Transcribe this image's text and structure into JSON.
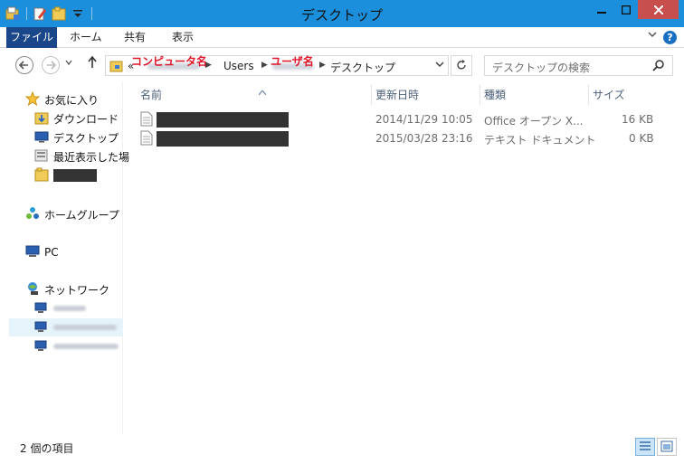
{
  "window": {
    "title": "デスクトップ"
  },
  "ribbon": {
    "tabs": [
      "ファイル",
      "ホーム",
      "共有",
      "表示"
    ]
  },
  "address": {
    "crumb_overflow": "«",
    "crumbs": [
      "Users",
      "デスクトップ"
    ],
    "annotations": {
      "computer_name": "コンピュータ名",
      "user_name": "ユーザ名"
    }
  },
  "search": {
    "placeholder": "デスクトップの検索"
  },
  "nav": {
    "favorites": "お気に入り",
    "downloads": "ダウンロード",
    "desktop": "デスクトップ",
    "recent": "最近表示した場",
    "homegroup": "ホームグループ",
    "pc": "PC",
    "network": "ネットワーク"
  },
  "columns": {
    "name": "名前",
    "modified": "更新日時",
    "type": "種類",
    "size": "サイズ"
  },
  "files": [
    {
      "modified": "2014/11/29 10:05",
      "type": "Office オープン X...",
      "size": "16 KB"
    },
    {
      "modified": "2015/03/28 23:16",
      "type": "テキスト ドキュメント",
      "size": "0 KB"
    }
  ],
  "status": {
    "item_count": "2 個の項目"
  },
  "colors": {
    "titlebar": "#1b8fdc",
    "file_tab": "#19478a",
    "close_button": "#c7504e",
    "annotation": "#e0162b"
  }
}
